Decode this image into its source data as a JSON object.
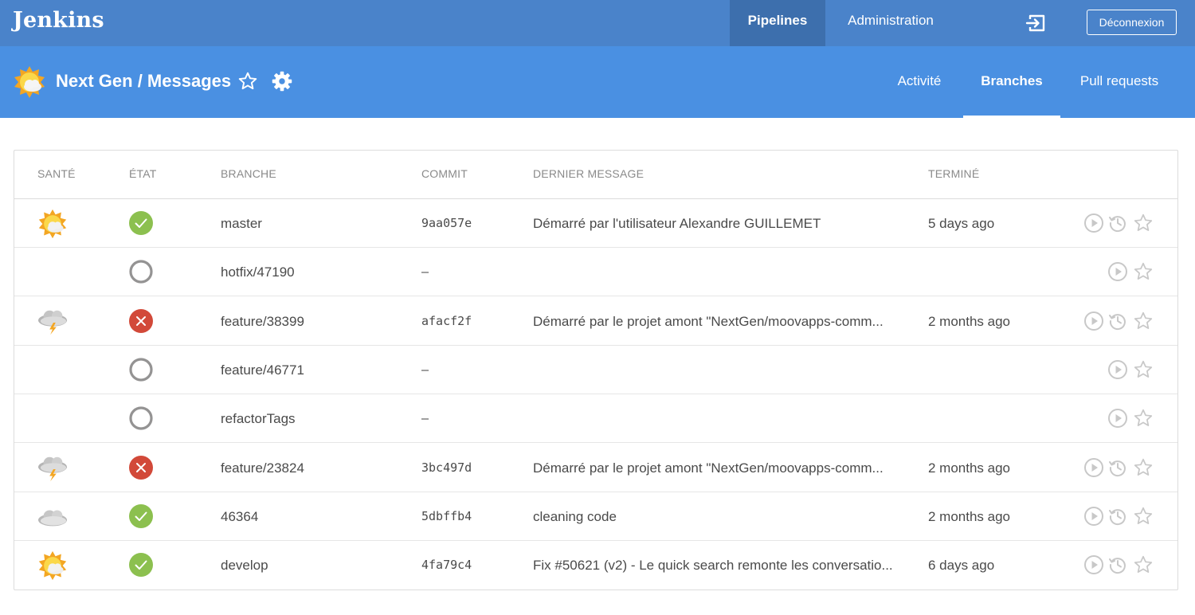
{
  "app": {
    "logo": "Jenkins"
  },
  "topnav": {
    "pipelines": "Pipelines",
    "administration": "Administration",
    "logout": "Déconnexion"
  },
  "header": {
    "title": "Next Gen / Messages",
    "tabs": {
      "activity": "Activité",
      "branches": "Branches",
      "pull_requests": "Pull requests"
    },
    "active_tab": "Branches"
  },
  "table": {
    "columns": {
      "health": "SANTÉ",
      "state": "ÉTAT",
      "branch": "BRANCHE",
      "commit": "COMMIT",
      "message": "DERNIER MESSAGE",
      "completed": "TERMINÉ"
    },
    "rows": [
      {
        "health": "sunny",
        "state": "success",
        "branch": "master",
        "commit": "9aa057e",
        "message": "Démarré par l'utilisateur Alexandre GUILLEMET",
        "completed": "5 days ago",
        "has_history": true
      },
      {
        "health": "none",
        "state": "not-built",
        "branch": "hotfix/47190",
        "commit": "–",
        "message": "",
        "completed": "",
        "has_history": false
      },
      {
        "health": "storm",
        "state": "failure",
        "branch": "feature/38399",
        "commit": "afacf2f",
        "message": "Démarré par le projet amont \"NextGen/moovapps-comm...",
        "completed": "2 months ago",
        "has_history": true
      },
      {
        "health": "none",
        "state": "not-built",
        "branch": "feature/46771",
        "commit": "–",
        "message": "",
        "completed": "",
        "has_history": false
      },
      {
        "health": "none",
        "state": "not-built",
        "branch": "refactorTags",
        "commit": "–",
        "message": "",
        "completed": "",
        "has_history": false
      },
      {
        "health": "storm",
        "state": "failure",
        "branch": "feature/23824",
        "commit": "3bc497d",
        "message": "Démarré par le projet amont \"NextGen/moovapps-comm...",
        "completed": "2 months ago",
        "has_history": true
      },
      {
        "health": "cloudy",
        "state": "success",
        "branch": "46364",
        "commit": "5dbffb4",
        "message": "cleaning code",
        "completed": "2 months ago",
        "has_history": true
      },
      {
        "health": "sunny",
        "state": "success",
        "branch": "develop",
        "commit": "4fa79c4",
        "message": "Fix #50621 (v2) - Le quick search remonte les conversatio...",
        "completed": "6 days ago",
        "has_history": true
      }
    ]
  },
  "icons": {
    "exit": "exit-icon",
    "star": "star-icon",
    "gear": "gear-icon",
    "run": "play-icon",
    "history": "history-icon",
    "health_sunny": "sunny-weather-icon",
    "health_storm": "storm-weather-icon",
    "health_cloudy": "cloudy-weather-icon",
    "state_success": "success-check-icon",
    "state_failure": "failure-x-icon",
    "state_not_built": "not-built-icon"
  },
  "colors": {
    "topbar": "#4a83ca",
    "topbar_active": "#3d6fad",
    "subheader": "#4a90e2",
    "success": "#8cc04f",
    "failure": "#d24939",
    "not_built": "#949393",
    "muted_icon": "#c8c8c8"
  }
}
